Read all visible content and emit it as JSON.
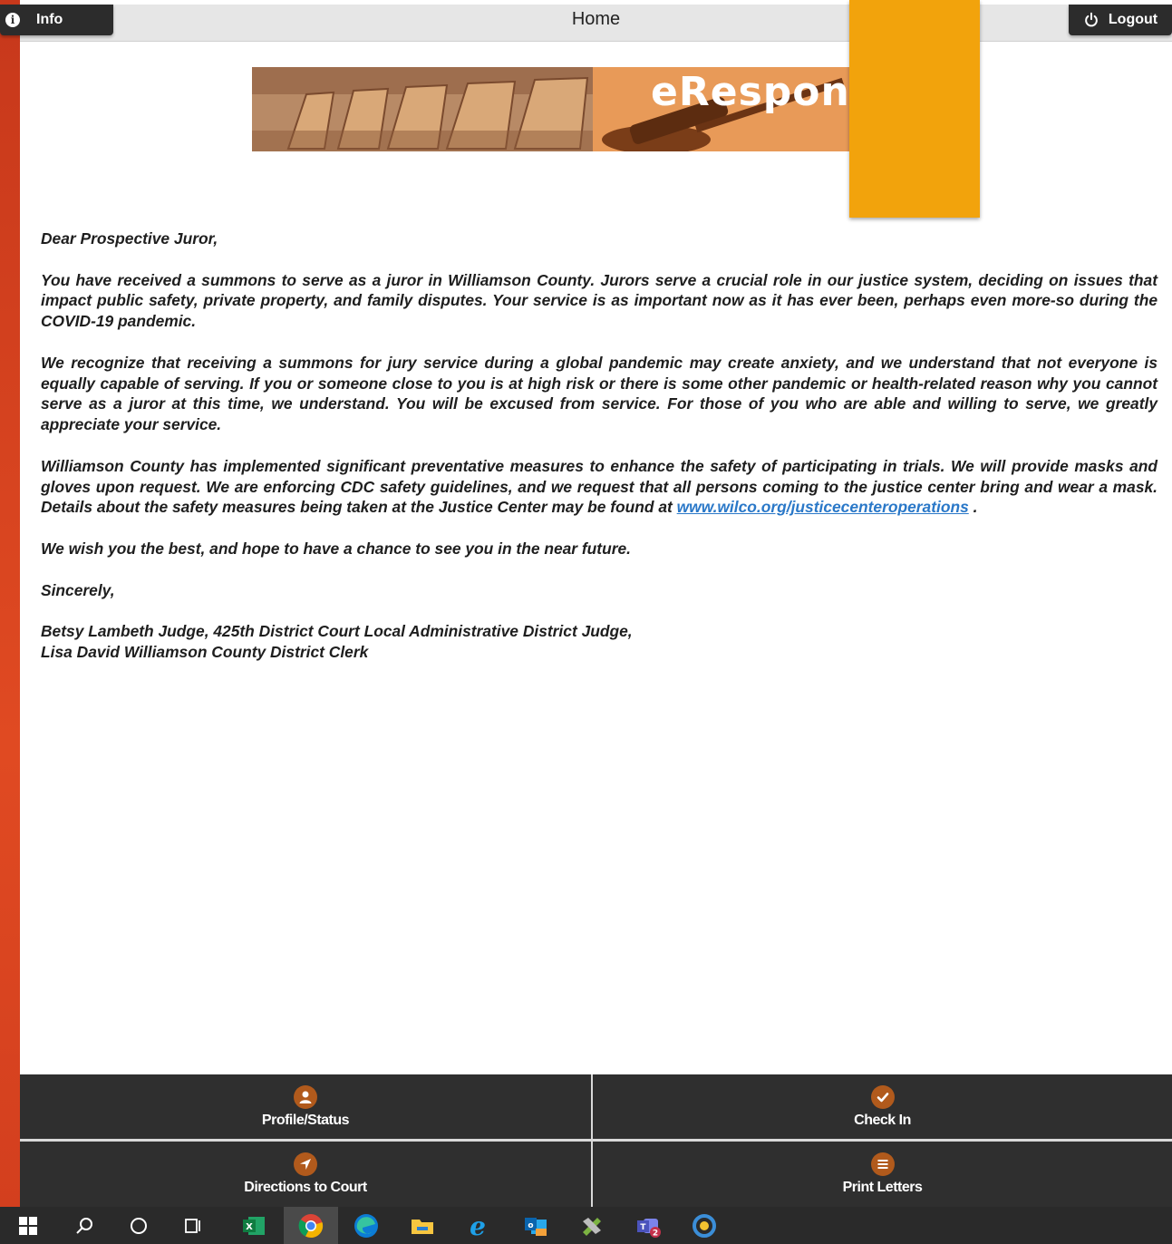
{
  "topbar": {
    "info_label": "Info",
    "title": "Home",
    "logout_label": "Logout"
  },
  "banner": {
    "title": "eRespons"
  },
  "letter": {
    "greeting": "Dear Prospective Juror,",
    "p1": "You have received a summons to serve as a juror in Williamson County. Jurors serve a crucial role in our justice system, deciding on issues that impact public safety, private property, and family disputes. Your service is as important now as it has ever been, perhaps even more-so during the COVID-19 pandemic.",
    "p2": "We recognize that receiving a summons for jury service during a global pandemic may create anxiety, and we understand that not everyone is equally capable of serving. If you or someone close to you is at high risk or there is some other pandemic or health-related reason why you cannot serve as a juror at this time, we understand. You will be excused from service. For those of you who are able and willing to serve, we greatly appreciate your service.",
    "p3": "Williamson County has implemented significant preventative measures to enhance the safety of participating in trials. We will provide masks and gloves upon request. We are enforcing CDC safety guidelines, and we request that all persons coming to the justice center bring and wear a mask. Details about the safety measures being taken at the Justice Center may be found at",
    "p3_link": "www.wilco.org/justicecenteroperations",
    "p3_end": " .",
    "p4": "We wish you the best, and hope to have a chance to see you in the near future.",
    "closing": "Sincerely,",
    "sig1": "Betsy Lambeth Judge, 425th District Court Local Administrative District Judge,",
    "sig2": "Lisa David Williamson County District Clerk"
  },
  "tiles": [
    {
      "label": "Profile/Status",
      "icon": "person-icon"
    },
    {
      "label": "Check In",
      "icon": "check-icon"
    },
    {
      "label": "Directions to Court",
      "icon": "navigation-arrow-icon"
    },
    {
      "label": "Print Letters",
      "icon": "menu-lines-icon"
    }
  ],
  "taskbar": {
    "icons": [
      "windows-start-icon",
      "search-icon",
      "cortana-icon",
      "task-view-icon",
      "excel-icon",
      "chrome-icon",
      "edge-icon",
      "file-explorer-icon",
      "internet-explorer-icon",
      "outlook-icon",
      "app-icon",
      "teams-icon",
      "app-icon-2"
    ]
  },
  "colors": {
    "accent_orange": "#f2a30c",
    "tile_icon": "#b15a1c",
    "tile_bg": "#2f2f2f",
    "link": "#2a78c8"
  }
}
